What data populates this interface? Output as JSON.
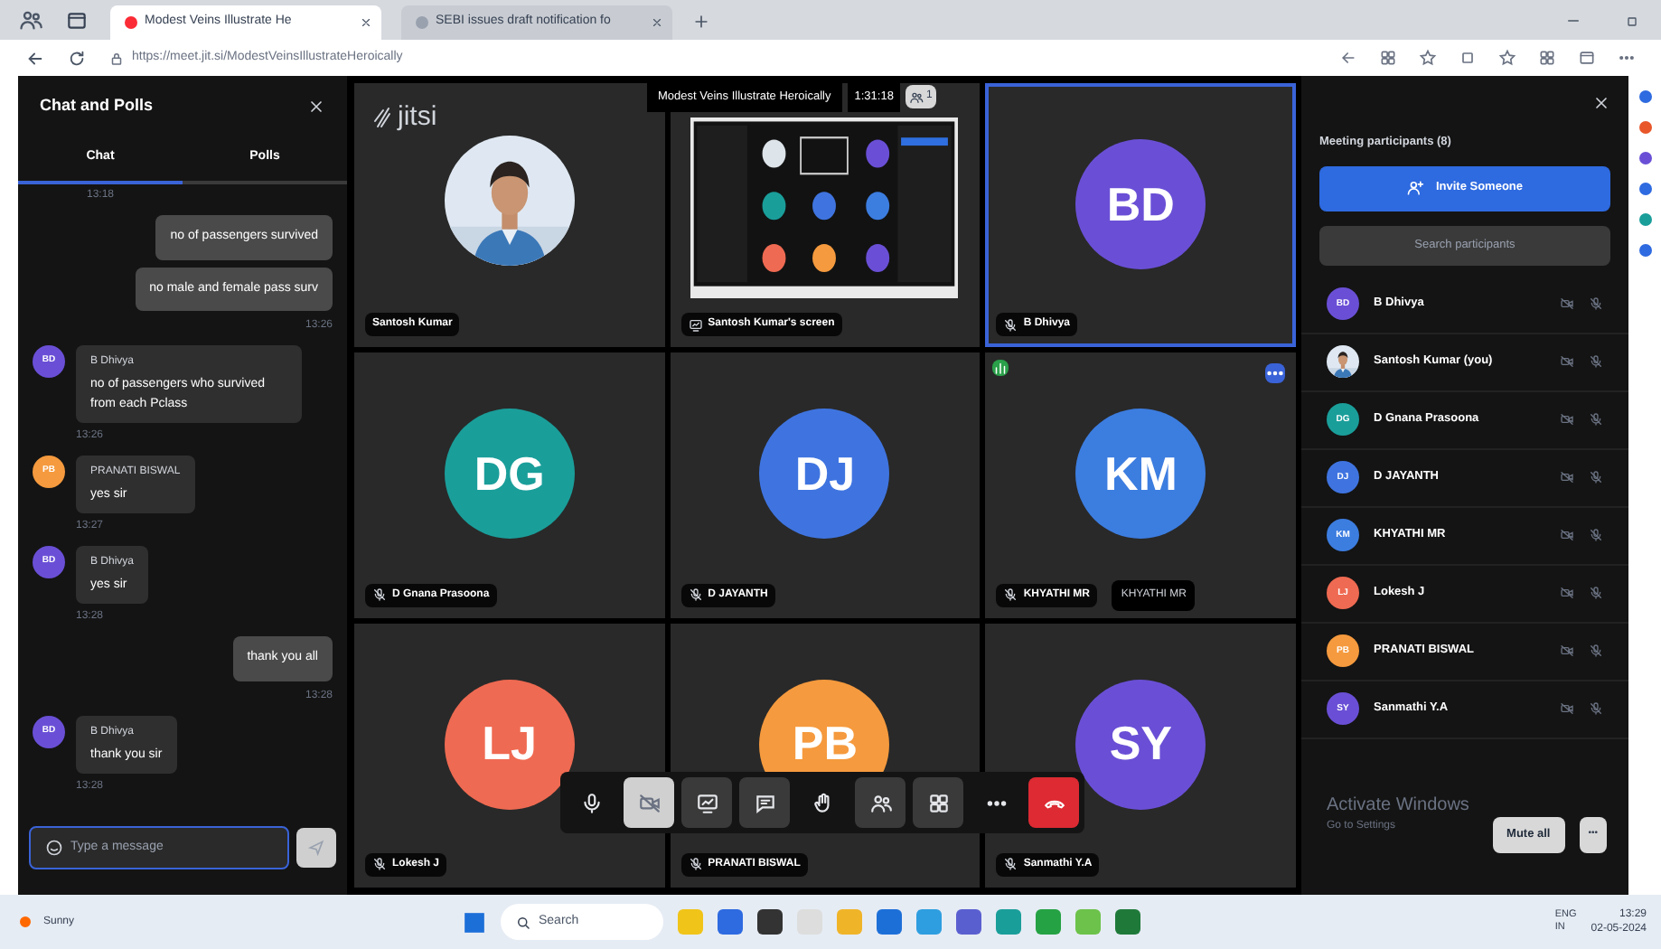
{
  "browser": {
    "tabs": [
      {
        "title": "Modest Veins Illustrate He",
        "selected": true
      },
      {
        "title": "SEBI issues draft notification fo",
        "selected": false
      }
    ],
    "url": "https://meet.jit.si/ModestVeinsIllustrateHeroically"
  },
  "chat": {
    "title": "Chat and Polls",
    "tabs": [
      {
        "label": "Chat",
        "selected": true
      },
      {
        "label": "Polls",
        "selected": false
      }
    ],
    "messages": [
      {
        "kind": "time",
        "time": "13:18"
      },
      {
        "kind": "own",
        "texts": [
          "no of passengers survived",
          "no male and female pass surv"
        ],
        "time": "13:26"
      },
      {
        "kind": "other",
        "sender": "B Dhivya",
        "initials": "BD",
        "color": "#6a4fd6",
        "text": "no of passengers who survived from each Pclass",
        "time": "13:26"
      },
      {
        "kind": "other",
        "sender": "PRANATI BISWAL",
        "initials": "PB",
        "color": "#f59a3e",
        "text": "yes sir",
        "time": "13:27"
      },
      {
        "kind": "other",
        "sender": "B Dhivya",
        "initials": "BD",
        "color": "#6a4fd6",
        "text": "yes sir",
        "time": "13:28"
      },
      {
        "kind": "own",
        "texts": [
          "thank you all"
        ],
        "time": "13:28"
      },
      {
        "kind": "other",
        "sender": "B Dhivya",
        "initials": "BD",
        "color": "#6a4fd6",
        "text": "thank you sir",
        "time": "13:28"
      }
    ],
    "input": {
      "placeholder": "Type a message"
    }
  },
  "meeting": {
    "logo": "jitsi",
    "title": "Modest Veins Illustrate Heroically",
    "timer": "1:31:18",
    "badge": "1",
    "tiles": [
      {
        "name": "Santosh Kumar",
        "selected": false
      },
      {
        "kind": "screen",
        "name": "Santosh Kumar's screen",
        "selected": false
      },
      {
        "kind": "initials",
        "initials": "BD",
        "name": "B Dhivya",
        "color": "#6a4fd6",
        "selected": true
      },
      {
        "kind": "initials",
        "initials": "DG",
        "name": "D Gnana Prasoona",
        "color": "#1a9e9a",
        "selected": false
      },
      {
        "kind": "initials",
        "initials": "DJ",
        "name": "D JAYANTH",
        "color": "#3f74e0",
        "selected": false
      },
      {
        "kind": "initials",
        "initials": "KM",
        "name": "KHYATHI MR",
        "color": "#3c7de0",
        "selected": false,
        "tooltip": "KHYATHI MR"
      },
      {
        "kind": "initials",
        "initials": "LJ",
        "name": "Lokesh J",
        "color": "#ef6a52",
        "selected": false
      },
      {
        "kind": "initials",
        "initials": "PB",
        "name": "PRANATI BISWAL",
        "color": "#f59a3e",
        "selected": false
      },
      {
        "kind": "initials",
        "initials": "SY",
        "name": "Sanmathi Y.A",
        "color": "#6a4fd6",
        "selected": false
      }
    ]
  },
  "participants": {
    "title": "Meeting participants (8)",
    "invite": "Invite Someone",
    "search_placeholder": "Search participants",
    "list": [
      {
        "name": "B Dhivya",
        "initials": "BD",
        "color": "#6a4fd6"
      },
      {
        "name": "Santosh Kumar (you)"
      },
      {
        "name": "D Gnana Prasoona",
        "initials": "DG",
        "color": "#1a9e9a"
      },
      {
        "name": "D JAYANTH",
        "initials": "DJ",
        "color": "#3f74e0"
      },
      {
        "name": "KHYATHI MR",
        "initials": "KM",
        "color": "#3c7de0"
      },
      {
        "name": "Lokesh J",
        "initials": "LJ",
        "color": "#ef6a52"
      },
      {
        "name": "PRANATI BISWAL",
        "initials": "PB",
        "color": "#f59a3e"
      },
      {
        "name": "Sanmathi Y.A",
        "initials": "SY",
        "color": "#6a4fd6"
      }
    ],
    "mute_all": "Mute all",
    "more": "•••"
  },
  "os_notice": [
    "Activate Windows",
    "Go to Settings"
  ],
  "taskbar": {
    "weather": "Sunny",
    "search": "Search",
    "lang": [
      "ENG",
      "IN"
    ],
    "time": "13:29",
    "date": "02-05-2024"
  }
}
